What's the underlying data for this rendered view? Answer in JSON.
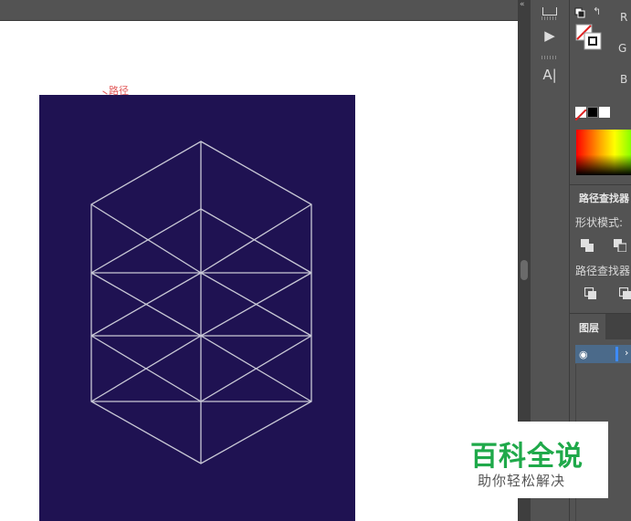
{
  "canvas": {
    "path_label": "路径",
    "artboard_color": "#1f1252",
    "line_color": "#c9c9d6"
  },
  "toolstrip": {
    "play_icon": "▶",
    "type_icon": "A|"
  },
  "color_panel": {
    "r_label": "R",
    "g_label": "G",
    "b_label": "B"
  },
  "pathfinder_panel": {
    "title": "路径查找器",
    "shape_modes_label": "形状模式:",
    "pathfinders_label": "路径查找器"
  },
  "layers_panel": {
    "title": "图层",
    "eye_icon": "◉",
    "expand_icon": "›"
  },
  "watermark": {
    "title": "百科全说",
    "subtitle": "助你轻松解决"
  }
}
